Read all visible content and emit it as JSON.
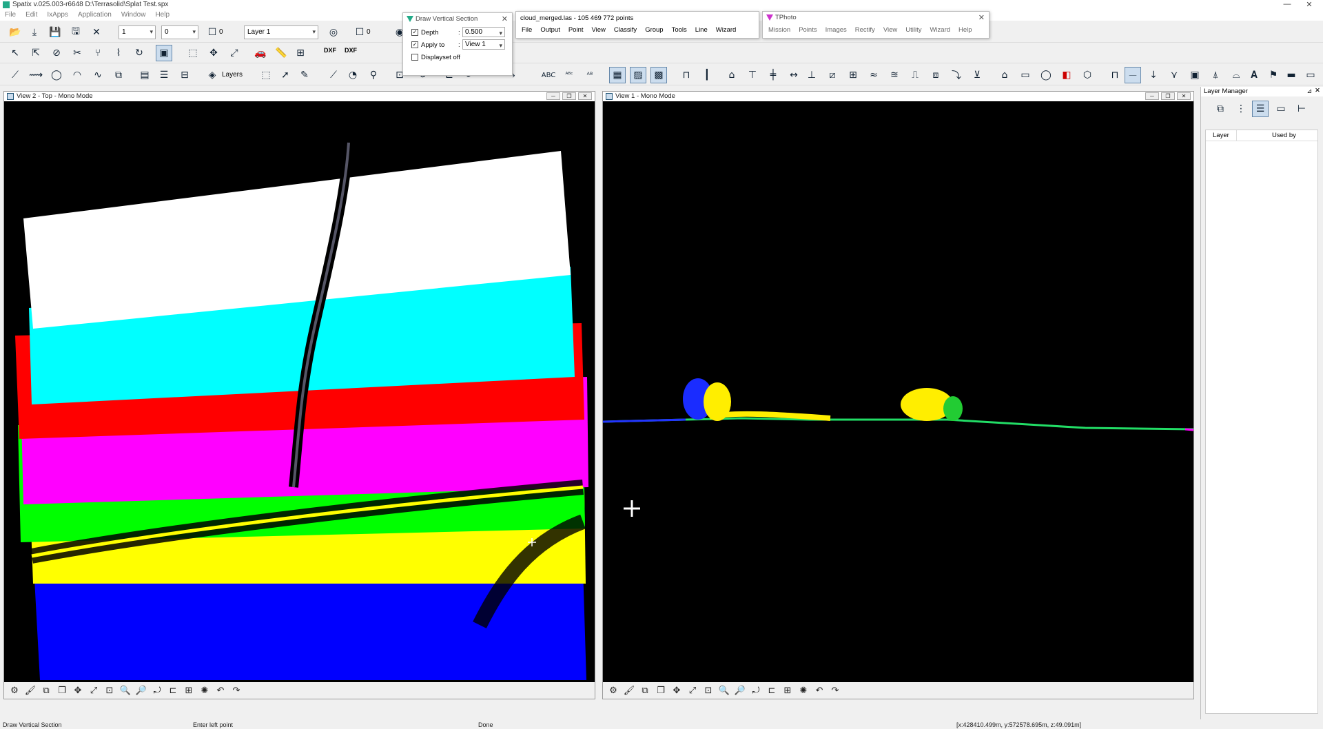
{
  "app": {
    "title": "Spatix v.025.003-r6648  D:\\Terrasolid\\Splat Test.spx",
    "min": "—",
    "max": "☐",
    "close": "✕"
  },
  "menu": [
    "File",
    "Edit",
    "IxApps",
    "Application",
    "Window",
    "Help"
  ],
  "toolbar": {
    "line_style": "1",
    "line_weight": "0",
    "color_value": "0",
    "layer": "Layer 1",
    "layers_label": "Layers",
    "dxf1": "DXF",
    "dxf2": "DXF"
  },
  "dvs": {
    "title": "Draw Vertical Section",
    "depth_label": "Depth",
    "depth_value": "0.500",
    "applyto_label": "Apply to",
    "applyto_value": "View 1",
    "displayset_label": "Displayset off"
  },
  "cloud": {
    "title": "cloud_merged.las - 105 469 772 points",
    "menu": [
      "File",
      "Output",
      "Point",
      "View",
      "Classify",
      "Group",
      "Tools",
      "Line",
      "Wizard"
    ]
  },
  "tphoto": {
    "title": "TPhoto",
    "menu": [
      "Mission",
      "Points",
      "Images",
      "Rectify",
      "View",
      "Utility",
      "Wizard",
      "Help"
    ]
  },
  "view2": {
    "title": "View 2 - Top - Mono Mode"
  },
  "view1": {
    "title": "View 1 - Mono Mode"
  },
  "layer_manager": {
    "title": "Layer Manager",
    "col_layer": "Layer",
    "col_used_by": "Used by"
  },
  "status": {
    "tool": "Draw Vertical Section",
    "prompt": "Enter left point",
    "msg": "Done",
    "coords": "[x:428410.499m, y:572578.695m, z:49.091m]"
  },
  "colors": {
    "white": "#ffffff",
    "cyan": "#00ffff",
    "red": "#ff0000",
    "magenta": "#ff00ff",
    "green": "#00ff00",
    "yellow": "#ffff00",
    "blue": "#0000ff"
  }
}
